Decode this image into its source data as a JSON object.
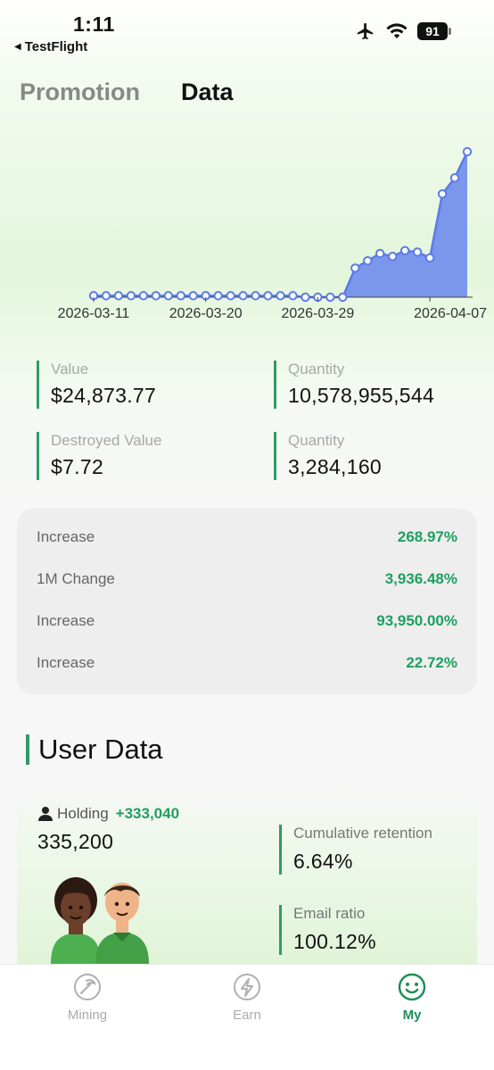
{
  "status_bar": {
    "time": "1:11",
    "back_app": "TestFlight",
    "battery": "91"
  },
  "top_tabs": [
    {
      "label": "Promotion",
      "active": false
    },
    {
      "label": "Data",
      "active": true
    }
  ],
  "chart_data": {
    "type": "area",
    "x_tick_labels": [
      "2026-03-11",
      "2026-03-20",
      "2026-03-29",
      "2026-04-07"
    ],
    "x": [
      "2026-03-11",
      "2026-03-12",
      "2026-03-13",
      "2026-03-14",
      "2026-03-15",
      "2026-03-16",
      "2026-03-17",
      "2026-03-18",
      "2026-03-19",
      "2026-03-20",
      "2026-03-21",
      "2026-03-22",
      "2026-03-23",
      "2026-03-24",
      "2026-03-25",
      "2026-03-26",
      "2026-03-27",
      "2026-03-28",
      "2026-03-29",
      "2026-03-30",
      "2026-03-31",
      "2026-04-01",
      "2026-04-02",
      "2026-04-03",
      "2026-04-04",
      "2026-04-05",
      "2026-04-06",
      "2026-04-07",
      "2026-04-08",
      "2026-04-09"
    ],
    "values": [
      1,
      1,
      1,
      1,
      1,
      1,
      1,
      1,
      1,
      1,
      1,
      1,
      1,
      1,
      1,
      1,
      1,
      0,
      0,
      0,
      0,
      20,
      25,
      30,
      28,
      32,
      31,
      27,
      71,
      82,
      100
    ],
    "ylim": [
      0,
      100
    ],
    "grid": false,
    "legend": "none",
    "series_color": "#5b7be8",
    "fill_color": "#7b97ec"
  },
  "stats": [
    {
      "label": "Value",
      "value": "$24,873.77"
    },
    {
      "label": "Quantity",
      "value": "10,578,955,544"
    },
    {
      "label": "Destroyed Value",
      "value": "$7.72"
    },
    {
      "label": "Quantity",
      "value": "3,284,160"
    }
  ],
  "changes": [
    {
      "label": "Increase",
      "value": "268.97%"
    },
    {
      "label": "1M Change",
      "value": "3,936.48%"
    },
    {
      "label": "Increase",
      "value": "93,950.00%"
    },
    {
      "label": "Increase",
      "value": "22.72%"
    }
  ],
  "user_data": {
    "title": "User Data",
    "holding_label": "Holding",
    "holding_delta": "+333,040",
    "holding_value": "335,200",
    "cumulative_retention_label": "Cumulative retention",
    "cumulative_retention_value": "6.64%",
    "email_ratio_label": "Email ratio",
    "email_ratio_value": "100.12%"
  },
  "tab_bar": [
    {
      "label": "Mining",
      "icon": "pickaxe-icon",
      "active": false
    },
    {
      "label": "Earn",
      "icon": "lightning-icon",
      "active": false
    },
    {
      "label": "My",
      "icon": "smiley-icon",
      "active": true
    }
  ],
  "colors": {
    "accent_green": "#1f9f60",
    "chart_blue": "#5b7be8"
  }
}
